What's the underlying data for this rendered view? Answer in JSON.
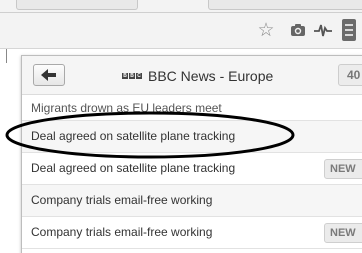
{
  "toolbar": {
    "icons": [
      "star-icon",
      "camera-icon",
      "pulse-icon",
      "menu-icon"
    ]
  },
  "popup": {
    "back_glyph": "arrow-left-icon",
    "feed_title": "BBC News - Europe",
    "logo_letters": [
      "B",
      "B",
      "C"
    ],
    "count": "40",
    "items": [
      {
        "title": "Migrants drown as EU leaders meet",
        "badge": "",
        "partial": true
      },
      {
        "title": "Deal agreed on satellite plane tracking",
        "badge": "",
        "circled": true
      },
      {
        "title": "Deal agreed on satellite plane tracking",
        "badge": "NEW"
      },
      {
        "title": "Company trials email-free working",
        "badge": ""
      },
      {
        "title": "Company trials email-free working",
        "badge": "NEW"
      }
    ]
  },
  "colors": {
    "panel_bg": "#ffffff",
    "header_bg": "#f5f5f5",
    "badge_bg": "#ebebeb",
    "annotation": "#000000"
  }
}
